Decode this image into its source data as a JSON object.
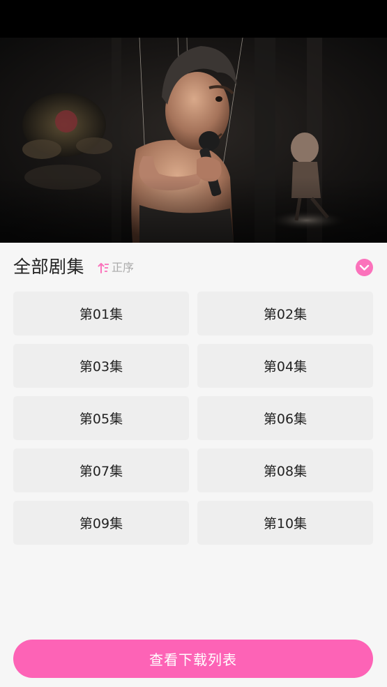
{
  "panel": {
    "title": "全部剧集",
    "sort_label": "正序"
  },
  "episodes": [
    {
      "label": "第01集"
    },
    {
      "label": "第02集"
    },
    {
      "label": "第03集"
    },
    {
      "label": "第04集"
    },
    {
      "label": "第05集"
    },
    {
      "label": "第06集"
    },
    {
      "label": "第07集"
    },
    {
      "label": "第08集"
    },
    {
      "label": "第09集"
    },
    {
      "label": "第10集"
    }
  ],
  "download_button": "查看下载列表",
  "colors": {
    "accent": "#fb72bb",
    "button_pink": "#fd63b6",
    "panel_bg": "#f6f6f6",
    "episode_bg": "#eeeeee"
  },
  "icons": {
    "sort": "sort-ascending-icon",
    "collapse": "chevron-down-icon"
  }
}
